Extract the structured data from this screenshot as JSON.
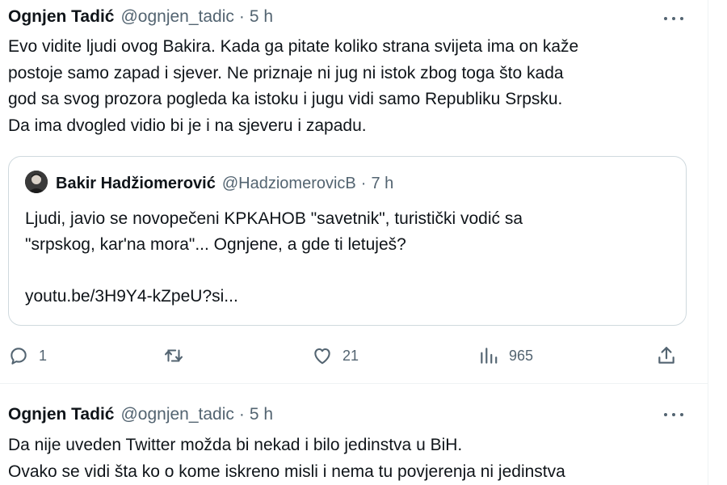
{
  "tweets": [
    {
      "author_name": "Ognjen Tadić",
      "handle": "@ognjen_tadic",
      "separator": "·",
      "time": "5 h",
      "more_icon": "more-horizontal-icon",
      "lines": [
        "Evo vidite ljudi ovog Bakira. Kada ga pitate koliko strana svijeta ima on kaže",
        "postoje samo zapad i sjever. Ne priznaje ni jug ni istok zbog toga što kada",
        "god sa svog prozora pogleda ka istoku i jugu vidi samo Republiku Srpsku.",
        "Da ima dvogled vidio bi je i na sjeveru i zapadu."
      ],
      "quote": {
        "author_name": "Bakir Hadžiomerović",
        "handle": "@HadziomerovicB",
        "separator": "·",
        "time": "7 h",
        "lines": [
          "Ljudi, javio se novopečeni KPKAHOB  \"savetnik\", turistički vodić sa",
          "\"srpskog, kar'na mora\"... Ognjene, a gde ti letuješ?",
          "",
          "youtu.be/3H9Y4-kZpeU?si..."
        ]
      },
      "actions": {
        "reply": {
          "icon": "reply-icon",
          "count": "1"
        },
        "retweet": {
          "icon": "retweet-icon",
          "count": ""
        },
        "like": {
          "icon": "heart-icon",
          "count": "21"
        },
        "views": {
          "icon": "views-chart-icon",
          "count": "965"
        },
        "share": {
          "icon": "share-icon",
          "count": ""
        }
      }
    },
    {
      "author_name": "Ognjen Tadić",
      "handle": "@ognjen_tadic",
      "separator": "·",
      "time": "5 h",
      "more_icon": "more-horizontal-icon",
      "lines": [
        "Da nije uveden Twitter možda bi nekad i bilo jedinstva u BiH.",
        "Ovako se vidi šta ko o kome iskreno misli i nema tu povjerenja ni jedinstva"
      ]
    }
  ],
  "colors": {
    "text": "#0f1419",
    "secondary": "#536471",
    "border": "#cfd9de",
    "divider": "#eff3f4"
  }
}
